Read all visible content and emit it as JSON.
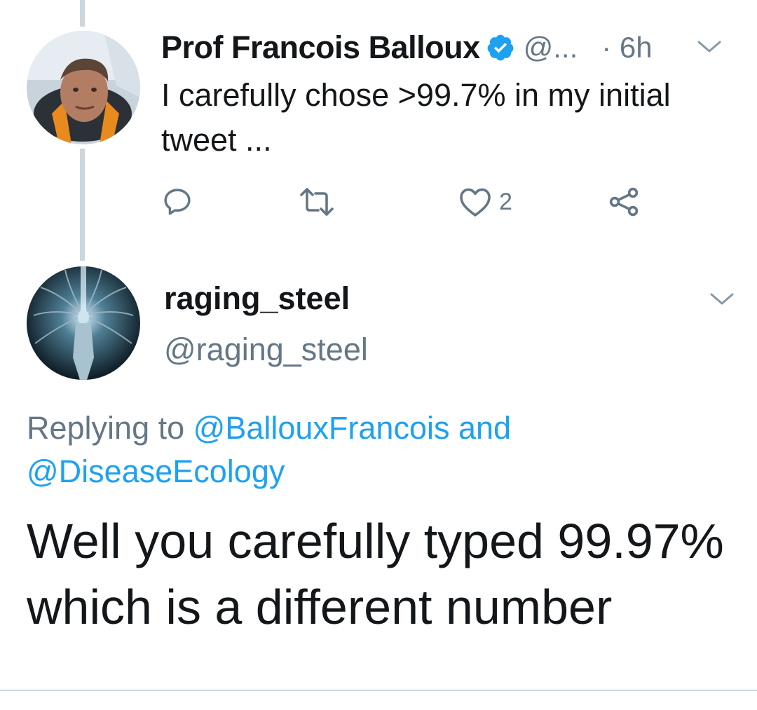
{
  "tweet1": {
    "display_name": "Prof Francois Balloux",
    "handle_truncated": "@...",
    "time": "· 6h",
    "text": "I carefully chose >99.7% in my initial tweet ...",
    "actions": {
      "reply_count": "",
      "retweet_count": "",
      "like_count": "2"
    }
  },
  "tweet2": {
    "display_name": "raging_steel",
    "handle": "@raging_steel",
    "replying_prefix": "Replying to ",
    "replying_user1": "@BallouxFrancois",
    "replying_and": " and ",
    "replying_user2": "@DiseaseEcology",
    "text": "Well you carefully typed 99.97% which is a different number"
  },
  "colors": {
    "accent": "#1da1f2",
    "secondary_text": "#657786",
    "primary_text": "#14171a",
    "thread_line": "#ccd6dd"
  },
  "icons": {
    "verified": "verified-badge-icon",
    "caret": "chevron-down-icon",
    "reply": "reply-icon",
    "retweet": "retweet-icon",
    "like": "heart-icon",
    "share": "share-icon"
  }
}
